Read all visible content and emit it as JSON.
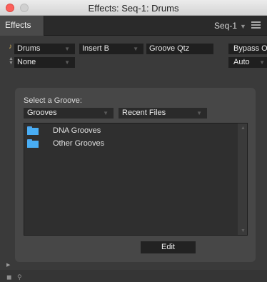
{
  "window": {
    "title": "Effects: Seq-1: Drums"
  },
  "header": {
    "tab_label": "Effects",
    "sequence_select": "Seq-1"
  },
  "controls": {
    "track": "Drums",
    "insert": "Insert B",
    "plugin": "Groove Qtz",
    "bypass": "Bypass Off",
    "preset": "None",
    "automation": "Auto"
  },
  "groove_panel": {
    "label": "Select a Groove:",
    "source_dropdown": "Grooves",
    "recent_dropdown": "Recent Files",
    "items": [
      {
        "label": "DNA Grooves",
        "icon": "folder-icon"
      },
      {
        "label": "Other Grooves",
        "icon": "folder-icon"
      }
    ],
    "edit_button": "Edit"
  },
  "colors": {
    "background": "#3a3a3a",
    "folder": "#49aef5",
    "close_button": "#fc605b"
  }
}
